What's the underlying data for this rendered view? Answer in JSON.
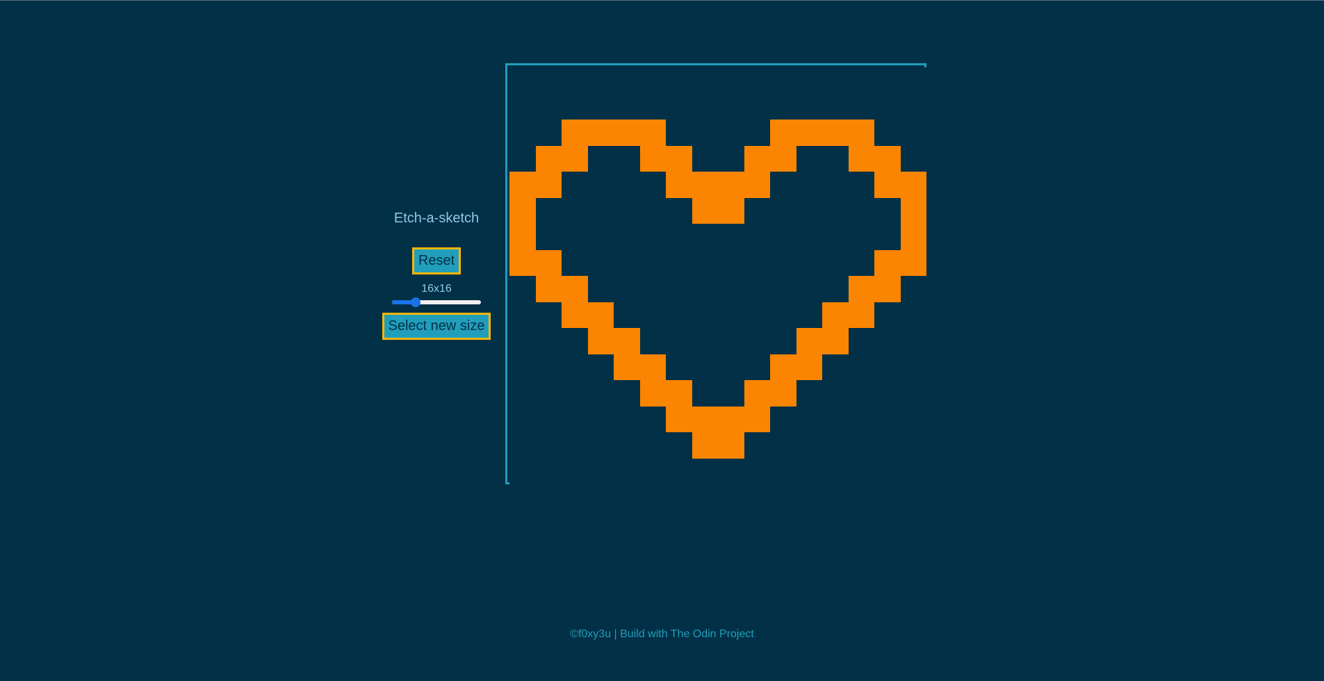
{
  "app": {
    "title": "Etch-a-sketch"
  },
  "controls": {
    "reset_label": "Reset",
    "size_label": "16x16",
    "slider_value": 16,
    "slider_min": 1,
    "slider_max": 64,
    "select_label": "Select new size"
  },
  "board": {
    "grid_size": 16,
    "paint_color": "#fb8500",
    "background_color": "#023047",
    "filled_cells": [
      [
        2,
        2
      ],
      [
        2,
        3
      ],
      [
        2,
        4
      ],
      [
        2,
        5
      ],
      [
        2,
        10
      ],
      [
        2,
        11
      ],
      [
        2,
        12
      ],
      [
        2,
        13
      ],
      [
        3,
        1
      ],
      [
        3,
        2
      ],
      [
        3,
        5
      ],
      [
        3,
        6
      ],
      [
        3,
        9
      ],
      [
        3,
        10
      ],
      [
        3,
        13
      ],
      [
        3,
        14
      ],
      [
        4,
        0
      ],
      [
        4,
        1
      ],
      [
        4,
        6
      ],
      [
        4,
        7
      ],
      [
        4,
        8
      ],
      [
        4,
        9
      ],
      [
        4,
        14
      ],
      [
        4,
        15
      ],
      [
        5,
        0
      ],
      [
        5,
        7
      ],
      [
        5,
        8
      ],
      [
        5,
        15
      ],
      [
        6,
        0
      ],
      [
        6,
        15
      ],
      [
        7,
        0
      ],
      [
        7,
        1
      ],
      [
        7,
        14
      ],
      [
        7,
        15
      ],
      [
        8,
        1
      ],
      [
        8,
        2
      ],
      [
        8,
        13
      ],
      [
        8,
        14
      ],
      [
        9,
        2
      ],
      [
        9,
        3
      ],
      [
        9,
        12
      ],
      [
        9,
        13
      ],
      [
        10,
        3
      ],
      [
        10,
        4
      ],
      [
        10,
        11
      ],
      [
        10,
        12
      ],
      [
        11,
        4
      ],
      [
        11,
        5
      ],
      [
        11,
        10
      ],
      [
        11,
        11
      ],
      [
        12,
        5
      ],
      [
        12,
        6
      ],
      [
        12,
        9
      ],
      [
        12,
        10
      ],
      [
        13,
        6
      ],
      [
        13,
        7
      ],
      [
        13,
        8
      ],
      [
        13,
        9
      ],
      [
        14,
        7
      ],
      [
        14,
        8
      ]
    ]
  },
  "footer": {
    "text": "©f0xy3u | Build with The Odin Project"
  }
}
